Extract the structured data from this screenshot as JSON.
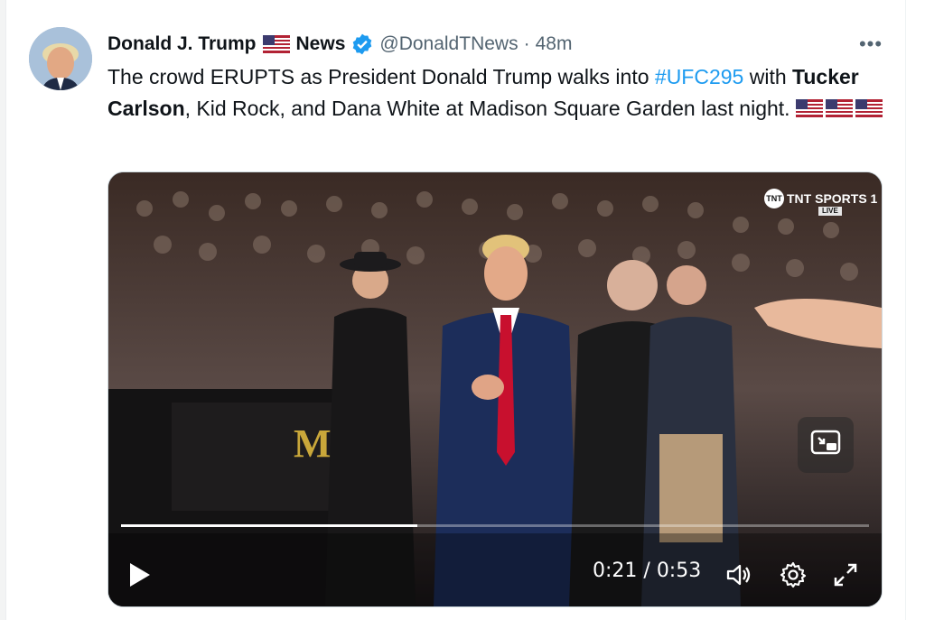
{
  "tweet": {
    "display_name": "Donald J. Trump",
    "name_suffix": "News",
    "handle": "@DonaldTNews",
    "separator": "·",
    "time": "48m",
    "more_label": "•••",
    "text_part1": "The crowd ERUPTS as President Donald Trump walks into ",
    "hashtag": "#UFC295",
    "text_part2": " with ",
    "bold_name": "Tucker Carlson",
    "text_part3": ", Kid Rock, and Dana White at Madison Square Garden last night. "
  },
  "video": {
    "channel_logo": "TNT SPORTS 1",
    "channel_badge": "TNT",
    "live_label": "LIVE",
    "current_time": "0:21",
    "duration": "0:53",
    "time_separator": " / ",
    "progress": 0.396,
    "icons": [
      "play-icon",
      "volume-icon",
      "settings-gear-icon",
      "fullscreen-icon",
      "picture-in-picture-icon"
    ]
  },
  "colors": {
    "link": "#1d9bf0",
    "verified": "#1d9bf0",
    "muted_text": "#536471"
  }
}
